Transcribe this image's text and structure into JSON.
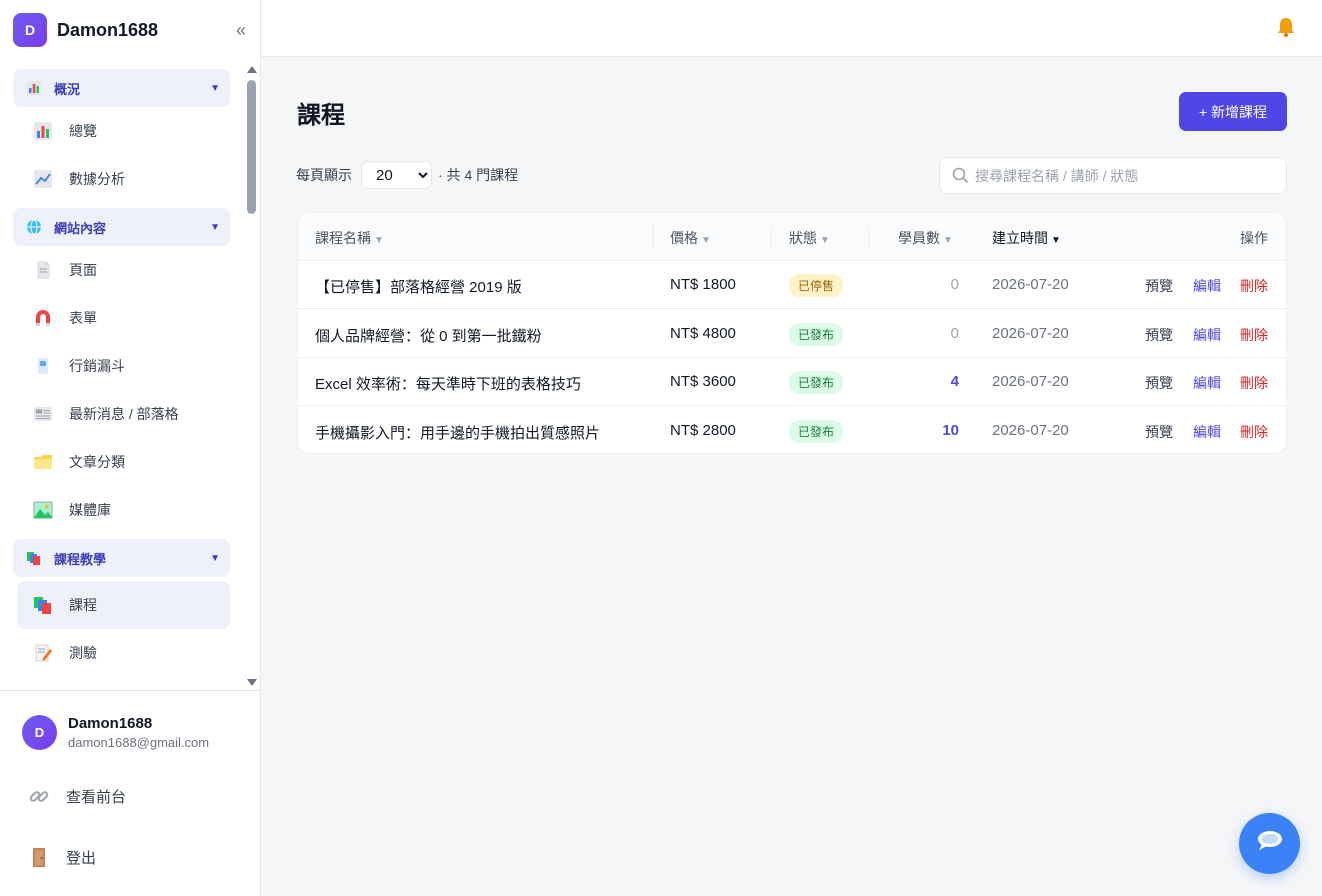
{
  "brand": {
    "initial": "D",
    "name": "Damon1688",
    "collapse_glyph": "«"
  },
  "colors": {
    "accent": "#4f46e5",
    "published": "#15803d",
    "stopped": "#a16207",
    "danger": "#dc2626"
  },
  "sidebar": {
    "groups": [
      {
        "label": "概況",
        "icon": "chart-icon",
        "items": [
          {
            "label": "總覽",
            "icon": "bar-chart-icon"
          },
          {
            "label": "數據分析",
            "icon": "trend-chart-icon"
          }
        ]
      },
      {
        "label": "網站內容",
        "icon": "globe-icon",
        "items": [
          {
            "label": "頁面",
            "icon": "page-icon"
          },
          {
            "label": "表單",
            "icon": "magnet-icon"
          },
          {
            "label": "行銷漏斗",
            "icon": "funnel-icon"
          },
          {
            "label": "最新消息 / 部落格",
            "icon": "newspaper-icon"
          },
          {
            "label": "文章分類",
            "icon": "folder-icon"
          },
          {
            "label": "媒體庫",
            "icon": "image-icon"
          }
        ]
      },
      {
        "label": "課程教學",
        "icon": "books-icon",
        "items": [
          {
            "label": "課程",
            "icon": "books-icon",
            "active": true
          },
          {
            "label": "測驗",
            "icon": "memo-icon"
          }
        ]
      }
    ]
  },
  "user": {
    "initial": "D",
    "name": "Damon1688",
    "email": "damon1688@gmail.com"
  },
  "footer_links": {
    "view_site": "查看前台",
    "logout": "登出"
  },
  "page": {
    "title": "課程",
    "add_button": "+ 新增課程",
    "per_page_label": "每頁顯示",
    "per_page_value": "20",
    "per_page_options": [
      "20"
    ],
    "total_text": "· 共 4 門課程",
    "search_placeholder": "搜尋課程名稱 / 講師 / 狀態"
  },
  "table": {
    "headers": {
      "name": "課程名稱",
      "price": "價格",
      "status": "狀態",
      "students": "學員數",
      "created": "建立時間",
      "actions": "操作"
    },
    "sort_glyph": "▼",
    "action_labels": {
      "preview": "預覽",
      "edit": "編輯",
      "delete": "刪除"
    },
    "rows": [
      {
        "name": "【已停售】部落格經營 2019 版",
        "price": "NT$ 1800",
        "status": "已停售",
        "status_type": "stopped",
        "students": "0",
        "created": "2026-07-20"
      },
      {
        "name": "個人品牌經營：從 0 到第一批鐵粉",
        "price": "NT$ 4800",
        "status": "已發布",
        "status_type": "published",
        "students": "0",
        "created": "2026-07-20"
      },
      {
        "name": "Excel 效率術：每天準時下班的表格技巧",
        "price": "NT$ 3600",
        "status": "已發布",
        "status_type": "published",
        "students": "4",
        "created": "2026-07-20"
      },
      {
        "name": "手機攝影入門：用手邊的手機拍出質感照片",
        "price": "NT$ 2800",
        "status": "已發布",
        "status_type": "published",
        "students": "10",
        "created": "2026-07-20"
      }
    ]
  }
}
